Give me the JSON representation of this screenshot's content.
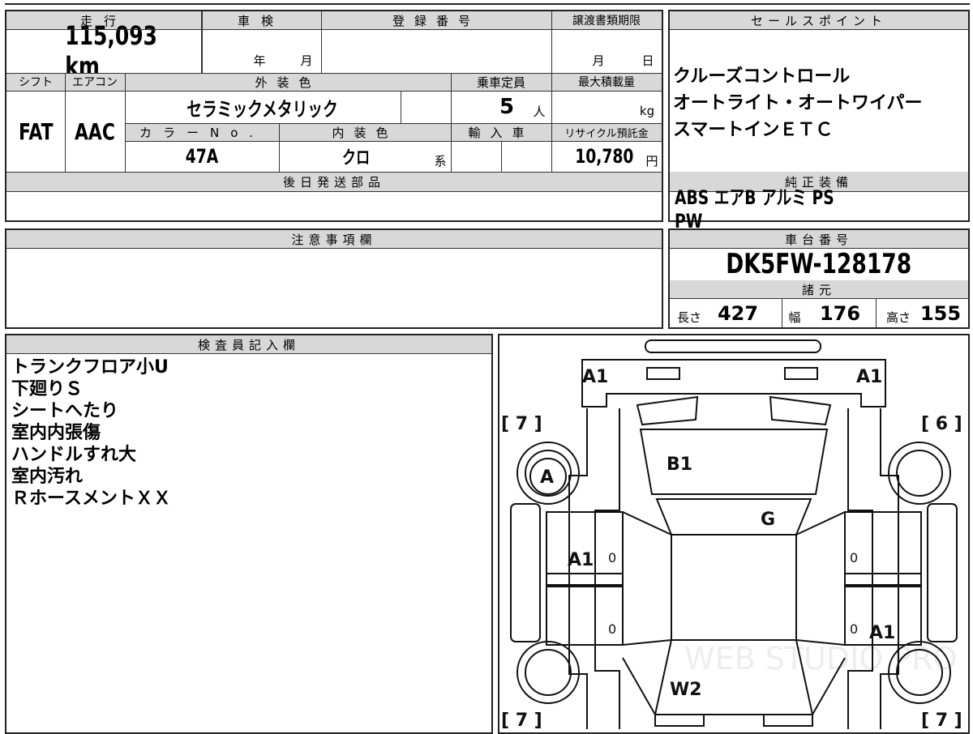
{
  "vehicle_info": {
    "mileage_label": "走行",
    "mileage_value": "115,093 km",
    "shaken_label": "車検",
    "shaken_year_unit": "年",
    "shaken_month_unit": "月",
    "registration_label": "登録番号",
    "transfer_label": "譲渡書類期限",
    "transfer_month_unit": "月",
    "transfer_day_unit": "日",
    "shift_label": "シフト",
    "shift_value": "FAT",
    "aircon_label": "エアコン",
    "aircon_value": "AAC",
    "exterior_color_label": "外装色",
    "exterior_color_value": "セラミックメタリック",
    "capacity_label": "乗車定員",
    "capacity_value": "5",
    "capacity_unit": "人",
    "max_load_label": "最大積載量",
    "max_load_unit": "kg",
    "color_no_label": "カラーNo.",
    "color_no_value": "47A",
    "interior_color_label": "内装色",
    "interior_color_value": "クロ",
    "interior_color_suffix": "系",
    "import_label": "輸入車",
    "recycle_label": "リサイクル預託金",
    "recycle_value": "10,780",
    "recycle_unit": "円",
    "later_parts_label": "後日発送部品"
  },
  "sales_points": {
    "label": "セールスポイント",
    "items": [
      "クルーズコントロール",
      "オートライト・オートワイパー",
      "スマートインＥＴＣ"
    ]
  },
  "genuine_equipment": {
    "label": "純正装備",
    "value": "ABS エアB アルミ PS PW"
  },
  "notes": {
    "label": "注意事項欄"
  },
  "chassis": {
    "label": "車台番号",
    "value": "DK5FW-128178",
    "spec_label": "諸元",
    "length_label": "長さ",
    "length_value": "427",
    "width_label": "幅",
    "width_value": "176",
    "height_label": "高さ",
    "height_value": "155"
  },
  "inspector": {
    "label": "検査員記入欄",
    "lines": [
      "トランクフロア小U",
      "下廻りＳ",
      "シートへたり",
      "室内内張傷",
      "ハンドルすれ大",
      "室内汚れ",
      "ＲホースメントＸＸ"
    ]
  },
  "diagram": {
    "marks": {
      "front_left": "A1",
      "front_right": "A1",
      "tire_fl": "[ 7 ]",
      "tire_fr": "[ 6 ]",
      "tire_rl": "[ 7 ]",
      "tire_rr": "[ 7 ]",
      "hood": "B1",
      "left_fender": "A",
      "windshield": "G",
      "left_door": "A1",
      "right_rear": "A1",
      "rear_glass": "W2",
      "zero_1": "0",
      "zero_2": "0",
      "zero_3": "0",
      "zero_4": "0"
    },
    "watermark": "WEB STUDIO PRO"
  }
}
